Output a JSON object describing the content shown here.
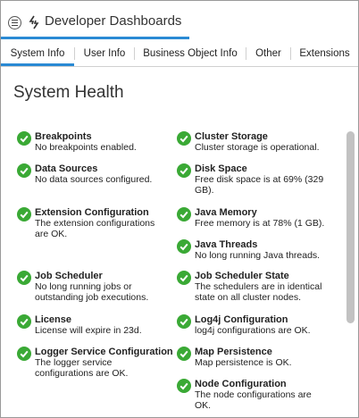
{
  "app": {
    "title": "Developer Dashboards"
  },
  "tabs": [
    {
      "label": "System Info",
      "active": true
    },
    {
      "label": "User Info",
      "active": false
    },
    {
      "label": "Business Object Info",
      "active": false
    },
    {
      "label": "Other",
      "active": false
    },
    {
      "label": "Extensions",
      "active": false
    }
  ],
  "page": {
    "title": "System Health"
  },
  "colors": {
    "accent": "#2a8ad4",
    "ok": "#3aa935"
  },
  "left_column": [
    {
      "name": "Breakpoints",
      "desc": "No breakpoints enabled.",
      "status": "ok"
    },
    {
      "name": "Data Sources",
      "desc": "No data sources configured.",
      "status": "ok"
    },
    {
      "name": "Extension Configuration",
      "desc": "The extension configurations are OK.",
      "status": "ok"
    },
    {
      "name": "Job Scheduler",
      "desc": "No long running jobs or outstanding job executions.",
      "status": "ok"
    },
    {
      "name": "License",
      "desc": "License will expire in 23d.",
      "status": "ok"
    },
    {
      "name": "Logger Service Configuration",
      "desc": "The logger service configurations are OK.",
      "status": "ok"
    }
  ],
  "right_column": [
    {
      "name": "Cluster Storage",
      "desc": "Cluster storage is operational.",
      "status": "ok"
    },
    {
      "name": "Disk Space",
      "desc": "Free disk space is at 69% (329 GB).",
      "status": "ok"
    },
    {
      "name": "Java Memory",
      "desc": "Free memory is at 78% (1 GB).",
      "status": "ok"
    },
    {
      "name": "Java Threads",
      "desc": "No long running Java threads.",
      "status": "ok"
    },
    {
      "name": "Job Scheduler State",
      "desc": "The schedulers are in identical state on all cluster nodes.",
      "status": "ok"
    },
    {
      "name": "Log4j Configuration",
      "desc": "log4j configurations are OK.",
      "status": "ok"
    },
    {
      "name": "Map Persistence",
      "desc": "Map persistence is OK.",
      "status": "ok"
    },
    {
      "name": "Node Configuration",
      "desc": "The node configurations are OK.",
      "status": "ok"
    }
  ]
}
